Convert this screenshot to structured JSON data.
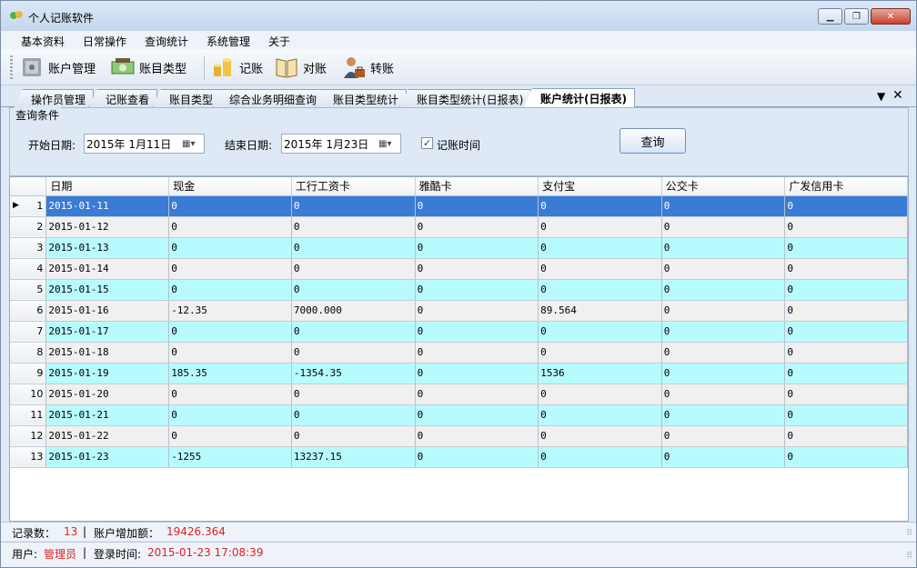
{
  "window": {
    "title": "个人记账软件",
    "accent": "#3a7bd5"
  },
  "menu": [
    "基本资料",
    "日常操作",
    "查询统计",
    "系统管理",
    "关于"
  ],
  "toolbar": [
    {
      "label": "账户管理",
      "icon": "safe-icon"
    },
    {
      "label": "账目类型",
      "icon": "money-icon"
    },
    {
      "label": "记账",
      "icon": "coins-icon"
    },
    {
      "label": "对账",
      "icon": "book-icon"
    },
    {
      "label": "转账",
      "icon": "user-briefcase-icon"
    }
  ],
  "tabs": [
    "操作员管理",
    "记账查看",
    "账目类型",
    "综合业务明细查询",
    "账目类型统计",
    "账目类型统计(日报表)",
    "账户统计(日报表)"
  ],
  "active_tab": 6,
  "query": {
    "legend": "查询条件",
    "start_label": "开始日期:",
    "start_value": "2015年 1月11日",
    "end_label": "结束日期:",
    "end_value": "2015年 1月23日",
    "checkbox_label": "记账时间",
    "checkbox_checked": true,
    "button_label": "查询"
  },
  "table": {
    "columns": [
      "日期",
      "现金",
      "工行工资卡",
      "雅酷卡",
      "支付宝",
      "公交卡",
      "广发信用卡"
    ],
    "rows": [
      [
        "1",
        "2015-01-11",
        "0",
        "0",
        "0",
        "0",
        "0",
        "0"
      ],
      [
        "2",
        "2015-01-12",
        "0",
        "0",
        "0",
        "0",
        "0",
        "0"
      ],
      [
        "3",
        "2015-01-13",
        "0",
        "0",
        "0",
        "0",
        "0",
        "0"
      ],
      [
        "4",
        "2015-01-14",
        "0",
        "0",
        "0",
        "0",
        "0",
        "0"
      ],
      [
        "5",
        "2015-01-15",
        "0",
        "0",
        "0",
        "0",
        "0",
        "0"
      ],
      [
        "6",
        "2015-01-16",
        "-12.35",
        "7000.000",
        "0",
        "89.564",
        "0",
        "0"
      ],
      [
        "7",
        "2015-01-17",
        "0",
        "0",
        "0",
        "0",
        "0",
        "0"
      ],
      [
        "8",
        "2015-01-18",
        "0",
        "0",
        "0",
        "0",
        "0",
        "0"
      ],
      [
        "9",
        "2015-01-19",
        "185.35",
        "-1354.35",
        "0",
        "1536",
        "0",
        "0"
      ],
      [
        "10",
        "2015-01-20",
        "0",
        "0",
        "0",
        "0",
        "0",
        "0"
      ],
      [
        "11",
        "2015-01-21",
        "0",
        "0",
        "0",
        "0",
        "0",
        "0"
      ],
      [
        "12",
        "2015-01-22",
        "0",
        "0",
        "0",
        "0",
        "0",
        "0"
      ],
      [
        "13",
        "2015-01-23",
        "-1255",
        "13237.15",
        "0",
        "0",
        "0",
        "0"
      ]
    ],
    "selected_row": 0
  },
  "status1": {
    "count_label": "记录数：",
    "count_value": "13",
    "sep": "|",
    "total_label": "账户增加额：",
    "total_value": "19426.364"
  },
  "status2": {
    "user_label": "用户:",
    "user_value": "管理员",
    "sep": "|",
    "login_label": "登录时间:",
    "login_value": "2015-01-23 17:08:39"
  }
}
